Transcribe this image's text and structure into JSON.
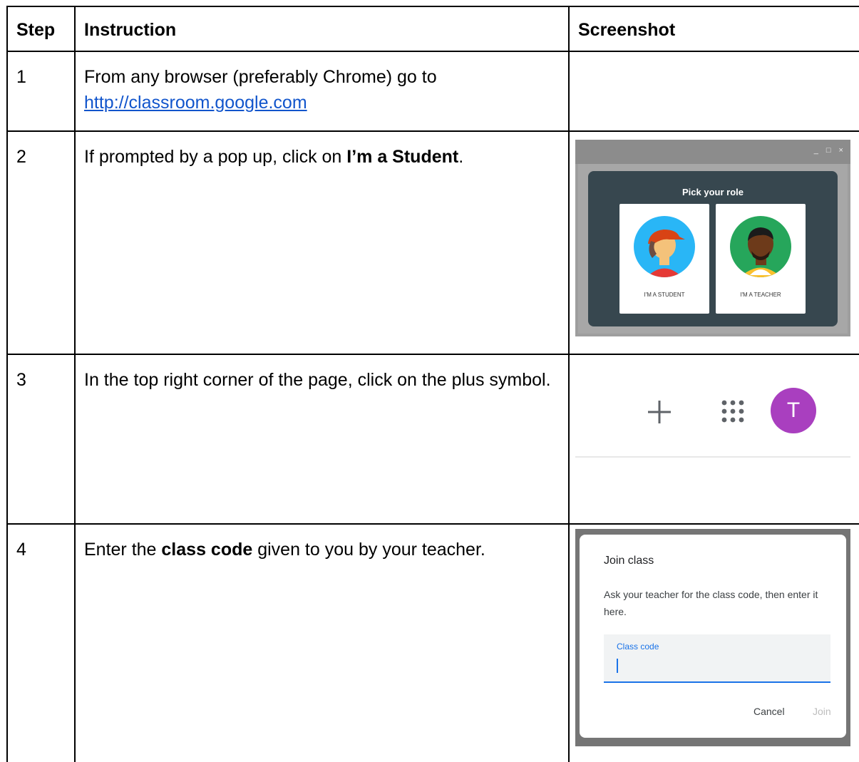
{
  "header": {
    "step": "Step",
    "instruction": "Instruction",
    "screenshot": "Screenshot"
  },
  "steps": [
    {
      "number": "1",
      "text_before": "From any browser (preferably Chrome) go to",
      "link": "http://classroom.google.com"
    },
    {
      "number": "2",
      "text_before": "If prompted by a pop up, click on ",
      "bold": "I’m a Student",
      "text_after": "."
    },
    {
      "number": "3",
      "text_before": "In the top right corner of the page, click on the plus symbol."
    },
    {
      "number": "4",
      "text_before": "Enter the ",
      "bold": "class code",
      "text_after": " given to you by your teacher."
    }
  ],
  "role_dialog": {
    "title": "Pick your role",
    "student_label": "I'M A STUDENT",
    "teacher_label": "I'M A TEACHER",
    "window_controls": "_ □ ×"
  },
  "toolbar": {
    "avatar_letter": "T",
    "avatar_color": "#a93fbf"
  },
  "join_dialog": {
    "title": "Join class",
    "description": "Ask your teacher for the class code, then enter it here.",
    "field_label": "Class code",
    "cancel": "Cancel",
    "join": "Join"
  }
}
